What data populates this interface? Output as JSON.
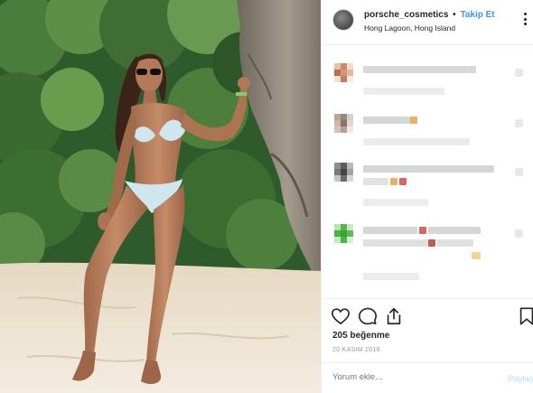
{
  "post": {
    "image_alt": "woman in bikini standing on beach beside rock",
    "username": "porsche_cosmetics",
    "separator": "•",
    "follow_label": "Takip Et",
    "location": "Hong Lagoon, Hong Island",
    "likes": "205 beğenme",
    "date": "20 KASIM 2018",
    "comment_placeholder": "Yorum ekle...",
    "post_label": "Paylaş"
  },
  "colors": {
    "accent": "#3897f0",
    "post_disabled": "#b2dffc",
    "text": "#262626",
    "muted": "#999999"
  },
  "icons": [
    "more-options-icon",
    "like-heart-icon",
    "comment-bubble-icon",
    "share-icon",
    "save-bookmark-icon"
  ]
}
